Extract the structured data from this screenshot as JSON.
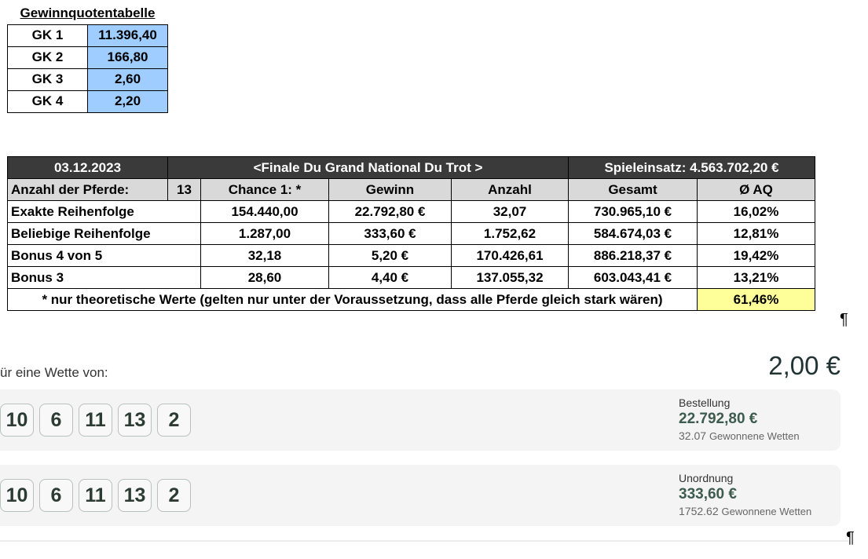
{
  "quote_table": {
    "title": "Gewinnquotentabelle",
    "rows": [
      {
        "label": "GK 1",
        "value": "11.396,40"
      },
      {
        "label": "GK 2",
        "value": "166,80"
      },
      {
        "label": "GK 3",
        "value": "2,60"
      },
      {
        "label": "GK 4",
        "value": "2,20"
      }
    ]
  },
  "main_table": {
    "date": "03.12.2023",
    "race": "<Finale Du Grand National Du Trot >",
    "stake": "Spieleinsatz: 4.563.702,20 €",
    "horses_label": "Anzahl der Pferde:",
    "horses_count": "13",
    "columns": [
      "Chance 1: *",
      "Gewinn",
      "Anzahl",
      "Gesamt",
      "Ø AQ"
    ],
    "rows": [
      {
        "name": "Exakte Reihenfolge",
        "chance": "154.440,00",
        "gewinn": "22.792,80 €",
        "anzahl": "32,07",
        "gesamt": "730.965,10 €",
        "aq": "16,02%"
      },
      {
        "name": "Beliebige Reihenfolge",
        "chance": "1.287,00",
        "gewinn": "333,60 €",
        "anzahl": "1.752,62",
        "gesamt": "584.674,03 €",
        "aq": "12,81%"
      },
      {
        "name": "Bonus 4 von 5",
        "chance": "32,18",
        "gewinn": "5,20 €",
        "anzahl": "170.426,61",
        "gesamt": "886.218,37 €",
        "aq": "19,42%"
      },
      {
        "name": "Bonus 3",
        "chance": "28,60",
        "gewinn": "4,40 €",
        "anzahl": "137.055,32",
        "gesamt": "603.043,41 €",
        "aq": "13,21%"
      }
    ],
    "footnote": "* nur theoretische Werte (gelten nur unter der Voraussetzung, dass alle Pferde gleich stark wären)",
    "total_aq": "61,46%"
  },
  "pilcrow": "¶",
  "bet": {
    "label": "ür eine Wette von:",
    "amount": "2,00 €",
    "panels": [
      {
        "numbers": [
          "10",
          "6",
          "11",
          "13",
          "2"
        ],
        "title": "Bestellung",
        "amount": "22.792,80 €",
        "count": "32.07",
        "count_label": "Gewonnene Wetten"
      },
      {
        "numbers": [
          "10",
          "6",
          "11",
          "13",
          "2"
        ],
        "title": "Unordnung",
        "amount": "333,60 €",
        "count": "1752.62",
        "count_label": "Gewonnene Wetten"
      }
    ]
  }
}
